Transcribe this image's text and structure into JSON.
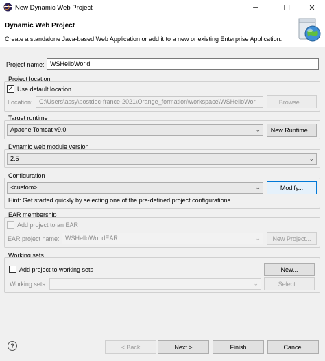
{
  "window": {
    "title": "New Dynamic Web Project",
    "minimize_label": "─",
    "maximize_label": "☐",
    "close_label": "✕"
  },
  "header": {
    "title": "Dynamic Web Project",
    "description": "Create a standalone Java-based Web Application or add it to a new or existing Enterprise Application."
  },
  "project_name": {
    "label": "Project name:",
    "value": "WSHelloWorld"
  },
  "project_location": {
    "group_label": "Project location",
    "use_default_label": "Use default location",
    "use_default_checked": true,
    "location_label": "Location:",
    "location_value": "C:\\Users\\assy\\postdoc-france-2021\\Orange_formation\\workspace\\WSHelloWor",
    "browse_label": "Browse..."
  },
  "target_runtime": {
    "group_label": "Target runtime",
    "selected": "Apache Tomcat v9.0",
    "new_runtime_label": "New Runtime..."
  },
  "module_version": {
    "group_label": "Dynamic web module version",
    "selected": "2.5"
  },
  "configuration": {
    "group_label": "Configuration",
    "selected": "<custom>",
    "modify_label": "Modify...",
    "hint": "Hint: Get started quickly by selecting one of the pre-defined project configurations."
  },
  "ear": {
    "group_label": "EAR membership",
    "add_label": "Add project to an EAR",
    "add_checked": false,
    "project_name_label": "EAR project name:",
    "project_name_value": "WSHelloWorldEAR",
    "new_project_label": "New Project..."
  },
  "working_sets": {
    "group_label": "Working sets",
    "add_label": "Add project to working sets",
    "add_checked": false,
    "new_label": "New...",
    "sets_label": "Working sets:",
    "sets_value": "",
    "select_label": "Select..."
  },
  "footer": {
    "help_symbol": "?",
    "back_label": "< Back",
    "next_label": "Next >",
    "finish_label": "Finish",
    "cancel_label": "Cancel"
  },
  "icons": {
    "app": "eclipse-icon",
    "wizard": "web-project-globe-icon",
    "checkmark": "✓",
    "dropdown": "⌄"
  }
}
